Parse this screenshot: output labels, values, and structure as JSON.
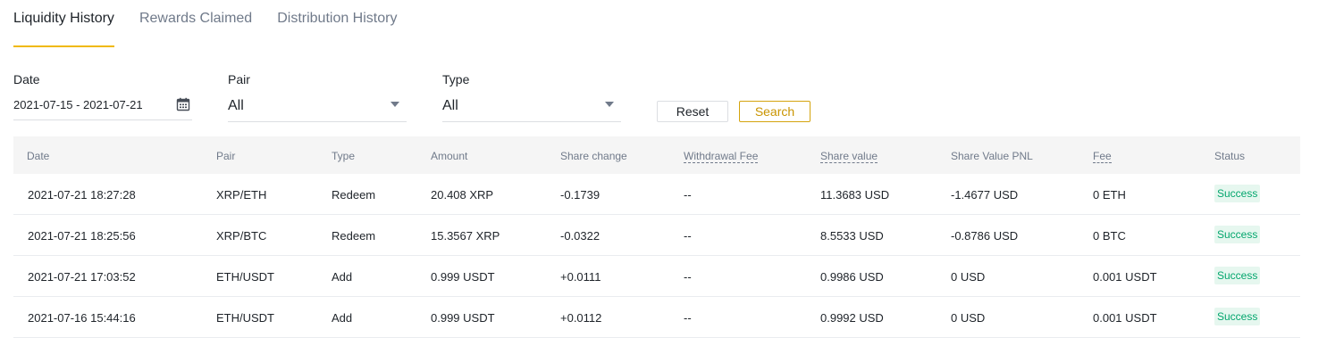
{
  "tabs": [
    {
      "label": "Liquidity History",
      "active": true
    },
    {
      "label": "Rewards Claimed",
      "active": false
    },
    {
      "label": "Distribution History",
      "active": false
    }
  ],
  "filters": {
    "date": {
      "label": "Date",
      "value": "2021-07-15 - 2021-07-21",
      "icon": "calendar-icon"
    },
    "pair": {
      "label": "Pair",
      "value": "All",
      "icon": "caret-down-icon"
    },
    "type": {
      "label": "Type",
      "value": "All",
      "icon": "caret-down-icon"
    },
    "reset_label": "Reset",
    "search_label": "Search"
  },
  "colors": {
    "accent": "#f0b90b",
    "success_text": "#03a66d",
    "success_bg": "#e6f7ef"
  },
  "table": {
    "headers": [
      "Date",
      "Pair",
      "Type",
      "Amount",
      "Share change",
      "Withdrawal Fee",
      "Share value",
      "Share Value PNL",
      "Fee",
      "Status"
    ],
    "rows": [
      [
        "2021-07-21 18:27:28",
        "XRP/ETH",
        "Redeem",
        "20.408 XRP",
        "-0.1739",
        "--",
        "11.3683 USD",
        "-1.4677 USD",
        "0 ETH",
        "Success"
      ],
      [
        "2021-07-21 18:25:56",
        "XRP/BTC",
        "Redeem",
        "15.3567 XRP",
        "-0.0322",
        "--",
        "8.5533 USD",
        "-0.8786 USD",
        "0 BTC",
        "Success"
      ],
      [
        "2021-07-21 17:03:52",
        "ETH/USDT",
        "Add",
        "0.999 USDT",
        "+0.0111",
        "--",
        "0.9986 USD",
        "0 USD",
        "0.001 USDT",
        "Success"
      ],
      [
        "2021-07-16 15:44:16",
        "ETH/USDT",
        "Add",
        "0.999 USDT",
        "+0.0112",
        "--",
        "0.9992 USD",
        "0 USD",
        "0.001 USDT",
        "Success"
      ]
    ]
  }
}
